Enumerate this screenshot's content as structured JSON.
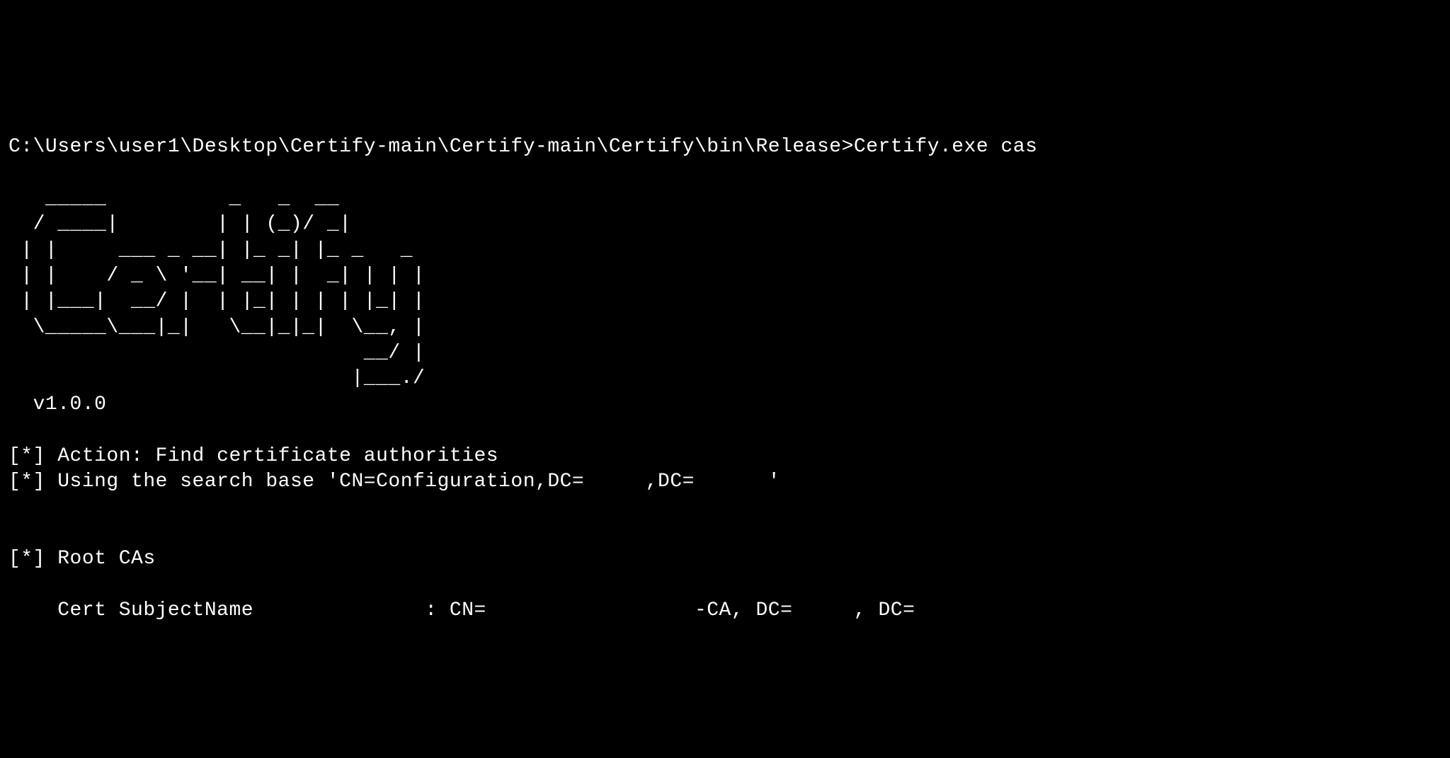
{
  "prompt": "C:\\Users\\user1\\Desktop\\Certify-main\\Certify-main\\Certify\\bin\\Release>Certify.exe cas",
  "ascii_art": "   _____          _   _  __\n  / ____|        | | (_)/ _|\n | |     ___ _ __| |_ _| |_ _   _\n | |    / _ \\ '__| __| |  _| | | |\n | |___|  __/ |  | |_| | | | |_| |\n  \\_____\\___|_|   \\__|_|_|  \\__, |\n                             __/ |\n                            |___./",
  "version": "  v1.0.0",
  "action_line": "[*] Action: Find certificate authorities",
  "search_base_line": "[*] Using the search base 'CN=Configuration,DC=     ,DC=      '",
  "root_cas_header": "[*] Root CAs",
  "cert_subject_line": "    Cert SubjectName              : CN=                 -CA, DC=     , DC="
}
